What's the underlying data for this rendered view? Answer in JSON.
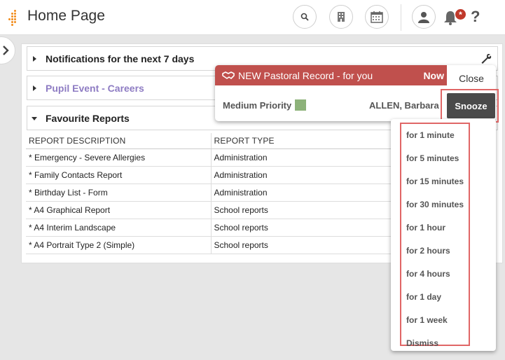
{
  "header": {
    "title": "Home Page",
    "notification_badge": "*",
    "help_label": "?",
    "icons": [
      "search-icon",
      "building-icon",
      "calendar-icon",
      "user-icon",
      "bell-icon",
      "help-icon"
    ]
  },
  "sections": {
    "notifications": {
      "label": "Notifications for the next 7 days"
    },
    "careers": {
      "label": "Pupil Event - Careers",
      "color": "#8e7cc3"
    },
    "favourites": {
      "label": "Favourite Reports"
    }
  },
  "reports": {
    "columns": [
      "REPORT DESCRIPTION",
      "REPORT TYPE"
    ],
    "rows": [
      [
        "* Emergency - Severe Allergies",
        "Administration"
      ],
      [
        "* Family Contacts Report",
        "Administration"
      ],
      [
        "* Birthday List - Form",
        "Administration"
      ],
      [
        "* A4 Graphical Report",
        "School reports"
      ],
      [
        "* A4 Interim Landscape",
        "School reports"
      ],
      [
        "* A4 Portrait Type 2 (Simple)",
        "School reports"
      ]
    ]
  },
  "popup": {
    "title": "NEW Pastoral Record - for you",
    "time": "Now",
    "close_label": "Close",
    "priority_label": "Medium Priority",
    "priority_color": "#8db27a",
    "pupil": "ALLEN, Barbara",
    "snooze_label": "Snooze",
    "bar_color": "#c0504d"
  },
  "snooze_menu": {
    "options": [
      "for 1 minute",
      "for 5 minutes",
      "for 15 minutes",
      "for 30 minutes",
      "for 1 hour",
      "for 2 hours",
      "for 4 hours",
      "for 1 day",
      "for 1 week",
      "Dismiss"
    ]
  }
}
